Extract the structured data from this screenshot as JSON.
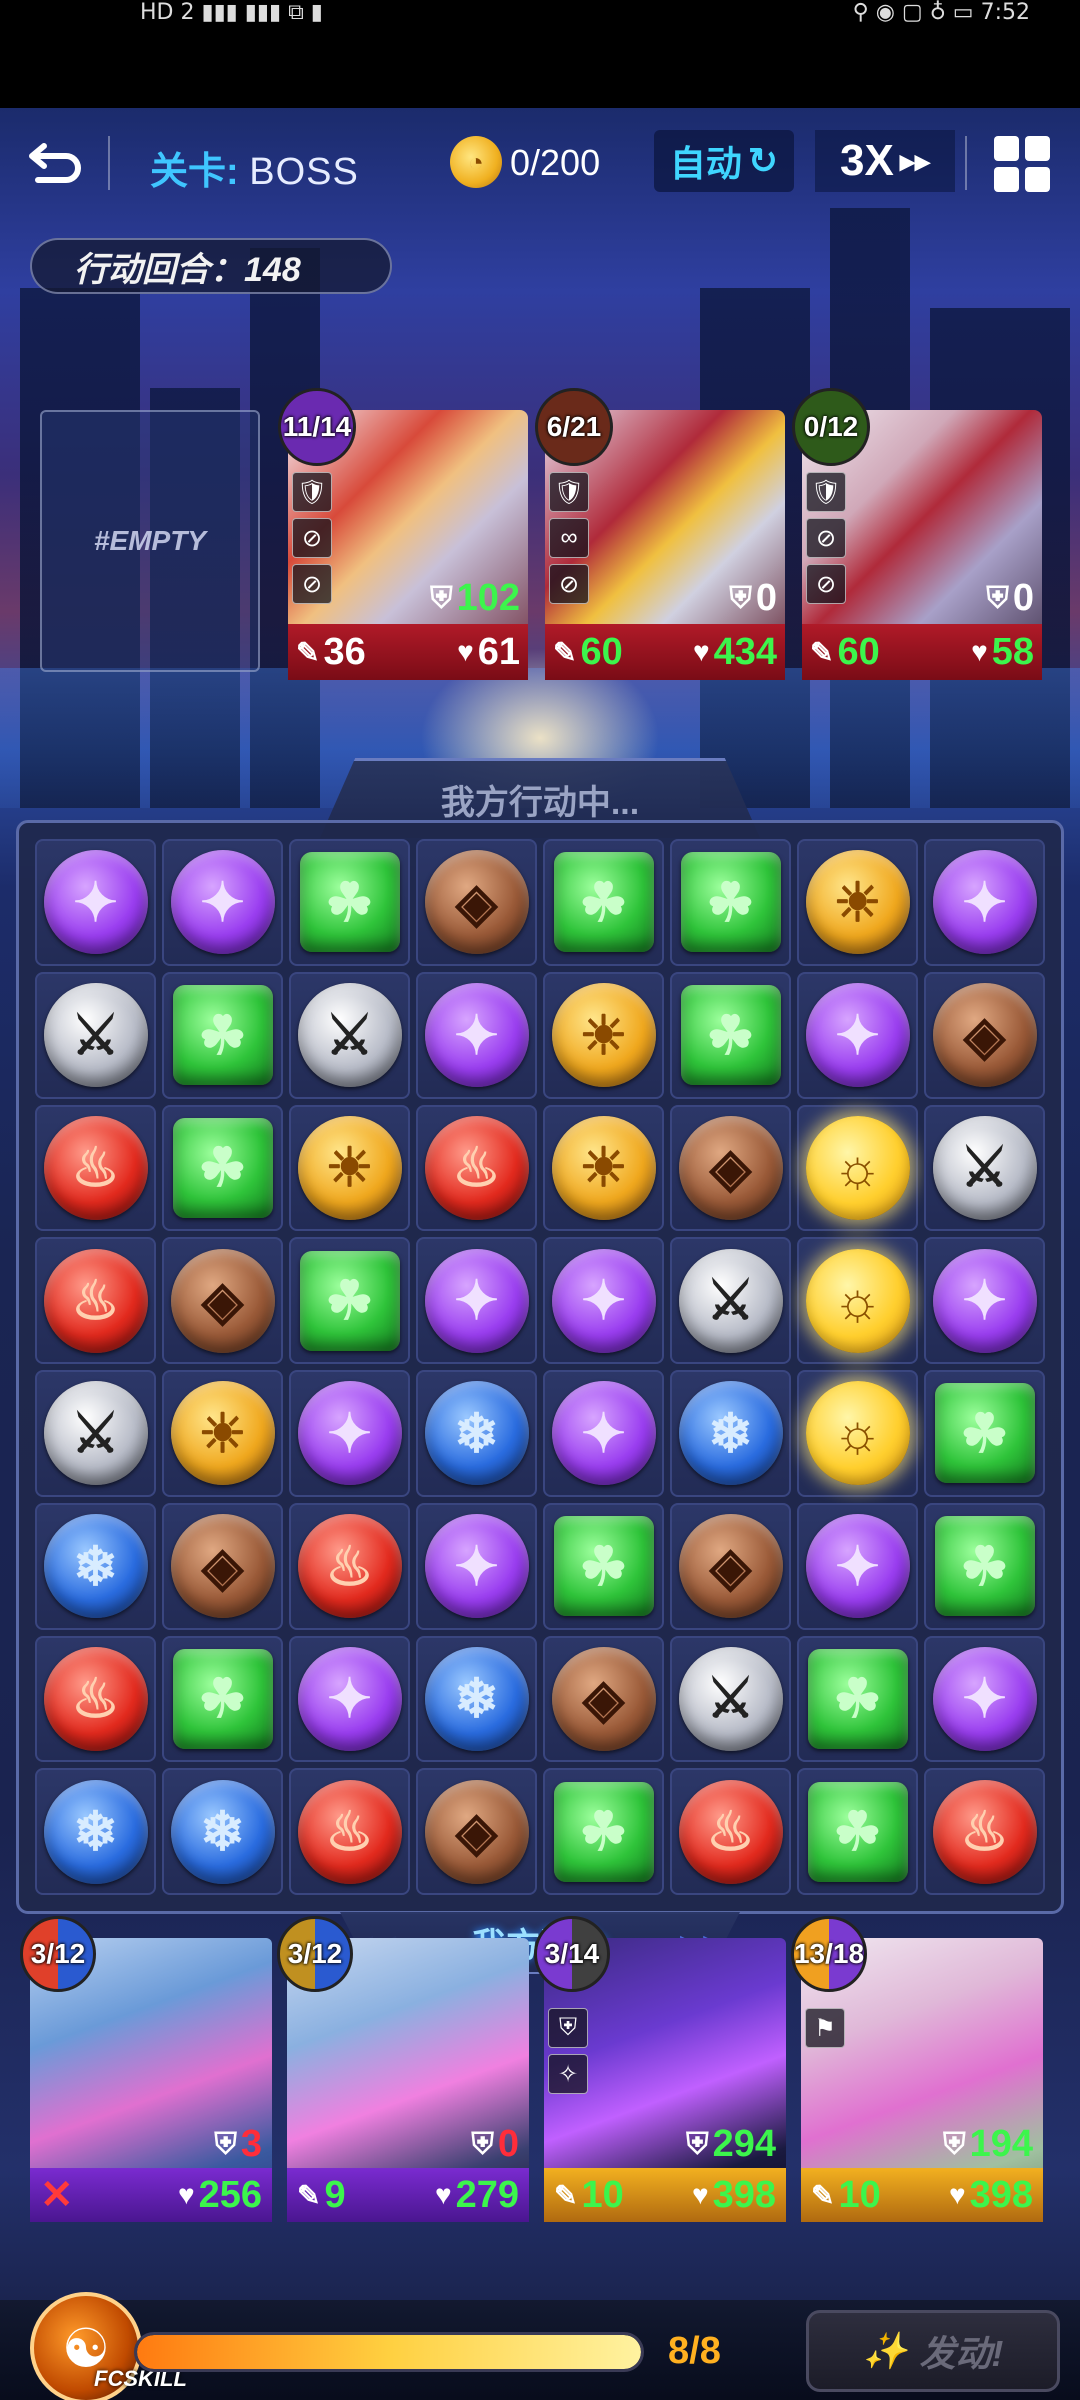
{
  "status_bar": {
    "left": "HD 2 ▮▮▮ ▮▮▮ ⧉ ▮",
    "right": "⚲ ◉ ▢ ♁ ▭ 7:52"
  },
  "topbar": {
    "stage_key": "关卡:",
    "stage_value": "BOSS",
    "coin_value": "0/200",
    "auto_label": "自动",
    "auto_icon": "↻",
    "speed_label": "3X",
    "speed_icon": "▸▸"
  },
  "turn_label": "行动回合：148",
  "empty_slot_label": "#EMPTY",
  "enemies": [
    {
      "cooldown": "11/14",
      "cd_color": "#6a2ab0",
      "icons": [
        "🛡",
        "⊘",
        "⊘"
      ],
      "shield": "102",
      "attack": "36",
      "hp": "61"
    },
    {
      "cooldown": "6/21",
      "cd_color": "#6a2a1a",
      "icons": [
        "🛡",
        "∞",
        "⊘"
      ],
      "shield": "0",
      "attack": "60",
      "hp": "434"
    },
    {
      "cooldown": "0/12",
      "cd_color": "#2e5a1a",
      "icons": [
        "🛡",
        "⊘",
        "⊘"
      ],
      "shield": "0",
      "attack": "60",
      "hp": "58"
    }
  ],
  "board_title": "我方行动中...",
  "board": [
    [
      "purple",
      "purple",
      "green",
      "brown",
      "green",
      "green",
      "gold",
      "purple"
    ],
    [
      "silver",
      "green",
      "silver",
      "purple",
      "gold",
      "green",
      "purple",
      "brown"
    ],
    [
      "red",
      "green",
      "gold",
      "red",
      "gold",
      "brown",
      "sun",
      "silver"
    ],
    [
      "red",
      "brown",
      "green",
      "purple",
      "purple",
      "silver",
      "sun",
      "purple"
    ],
    [
      "silver",
      "gold",
      "purple",
      "blue",
      "purple",
      "blue",
      "sun",
      "green"
    ],
    [
      "blue",
      "brown",
      "red",
      "purple",
      "green",
      "brown",
      "purple",
      "green"
    ],
    [
      "red",
      "green",
      "purple",
      "blue",
      "brown",
      "silver",
      "green",
      "purple"
    ],
    [
      "blue",
      "blue",
      "red",
      "brown",
      "green",
      "red",
      "green",
      "red"
    ]
  ],
  "gem_glyphs": {
    "purple": "✦",
    "green": "☘",
    "brown": "◈",
    "gold": "☀",
    "silver": "⚔",
    "red": "♨",
    "blue": "❄",
    "sun": "☼"
  },
  "round_banner": "我方回合",
  "heroes": [
    {
      "cooldown": "3/12",
      "shield": "3",
      "shield_color": "#ff2d3a",
      "attack": "",
      "hp": "256",
      "disabled": true,
      "icons": [],
      "skills": [
        "⛨",
        "✈",
        "⚔",
        "⛉"
      ]
    },
    {
      "cooldown": "3/12",
      "shield": "0",
      "shield_color": "#ff2d3a",
      "attack": "9",
      "hp": "279",
      "disabled": false,
      "icons": [],
      "skills": [
        "⛨",
        "✈",
        "⛉"
      ]
    },
    {
      "cooldown": "3/14",
      "shield": "294",
      "shield_color": "#3cf54c",
      "attack": "10",
      "hp": "398",
      "disabled": false,
      "icons": [
        "⛨",
        "✧"
      ],
      "skills": [
        "⛨",
        "✈",
        "⛉"
      ]
    },
    {
      "cooldown": "13/18",
      "shield": "194",
      "shield_color": "#3cf54c",
      "attack": "10",
      "hp": "398",
      "disabled": false,
      "icons": [
        "⚑"
      ],
      "skills": [
        "⛨",
        "✈",
        "⛉"
      ]
    }
  ],
  "bottom": {
    "fcskill_label": "FCSKILL",
    "energy_value": "8/8",
    "energy_fraction": 1.0,
    "launch_label": "发动!"
  }
}
